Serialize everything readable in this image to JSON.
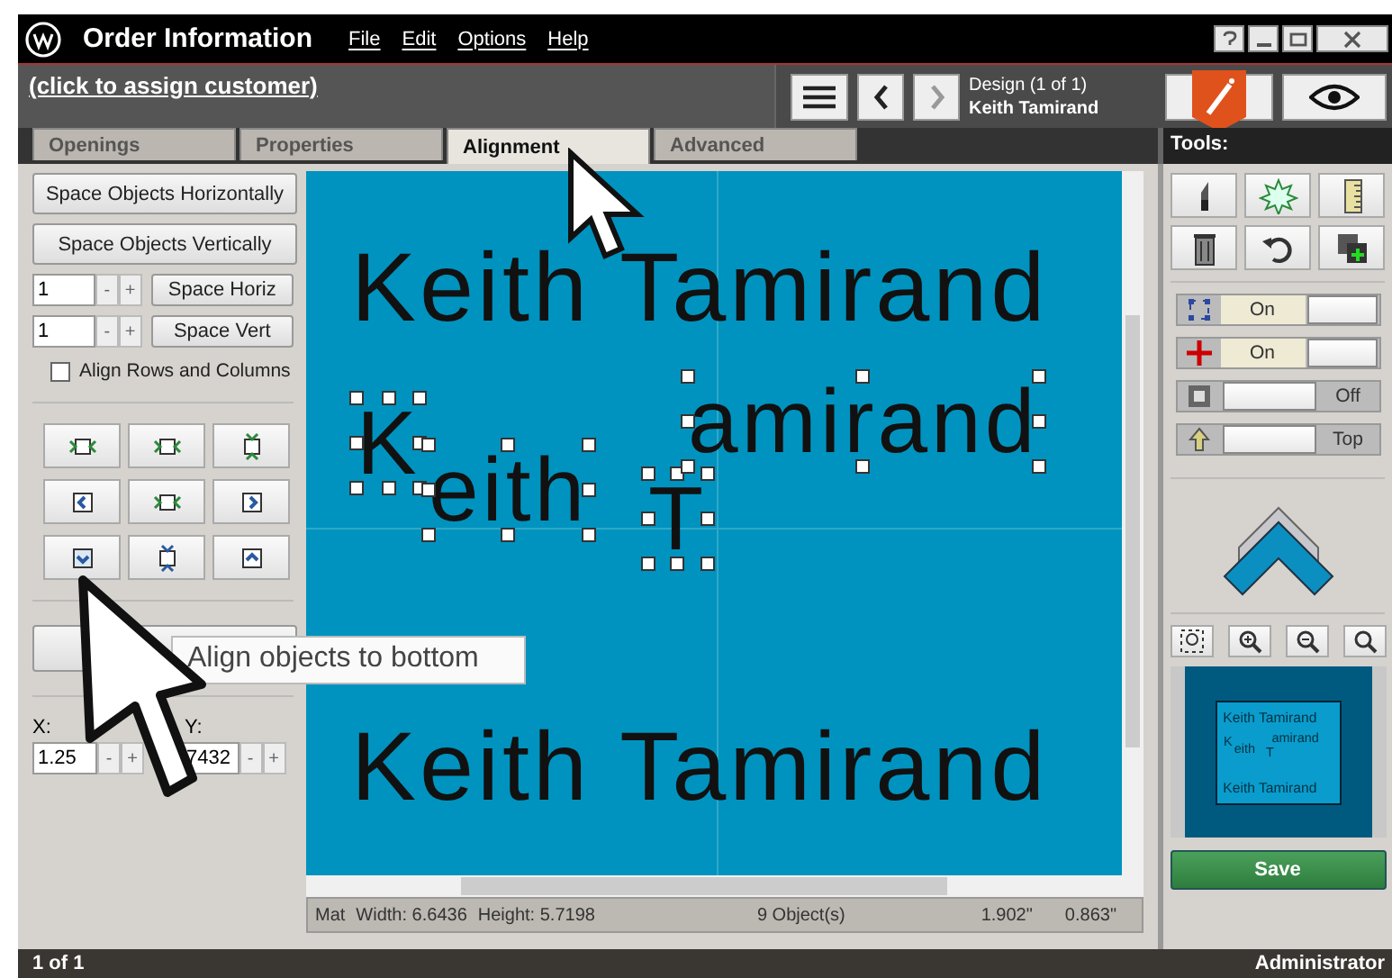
{
  "window": {
    "title": "Order Information",
    "menu": [
      "File",
      "Edit",
      "Options",
      "Help"
    ]
  },
  "customer_link": "(click to assign customer)",
  "design": {
    "label": "Design  (1 of 1)",
    "name": "Keith Tamirand"
  },
  "tabs": [
    {
      "label": "Openings",
      "selected": false
    },
    {
      "label": "Properties",
      "selected": false
    },
    {
      "label": "Alignment",
      "selected": true
    },
    {
      "label": "Advanced",
      "selected": false
    }
  ],
  "left_panel": {
    "buttons": [
      "Space Objects Horizontally",
      "Space Objects Vertically"
    ],
    "spacers": [
      {
        "value": "1",
        "minus": "-",
        "plus": "+",
        "button": "Space Horiz"
      },
      {
        "value": "1",
        "minus": "-",
        "plus": "+",
        "button": "Space Vert"
      }
    ],
    "align_rows": {
      "label": "Align Rows and Columns",
      "checked": false
    },
    "x": {
      "label": "X:",
      "value": "1.25",
      "minus": "-",
      "plus": "+"
    },
    "y": {
      "label": "Y:",
      "value": "7432",
      "minus": "-",
      "plus": "+"
    }
  },
  "canvas": {
    "objects": [
      {
        "text": "Keith Tamirand",
        "selected": false
      },
      {
        "text": "K",
        "selected": true
      },
      {
        "text": "eith",
        "selected": true
      },
      {
        "text": "T",
        "selected": true
      },
      {
        "text": "amirand",
        "selected": true
      },
      {
        "text": "Keith Tamirand",
        "selected": false
      }
    ],
    "status": {
      "mat": "Mat",
      "width": "Width: 6.6436",
      "height": "Height: 5.7198",
      "objects": "9 Object(s)",
      "x": "1.902\"",
      "y": "0.863\""
    }
  },
  "tooltip": "Align objects to bottom",
  "tools": {
    "title": "Tools:",
    "toggles": [
      {
        "label": "On",
        "on": true
      },
      {
        "label": "On",
        "on": true
      },
      {
        "label": "Off",
        "on": false
      },
      {
        "label": "Top",
        "on": false
      }
    ],
    "preview": [
      "Keith Tamirand",
      "K",
      "eith",
      "T",
      "amirand",
      "Keith Tamirand"
    ],
    "save": "Save"
  },
  "footer": {
    "left": "1 of 1",
    "right": "Administrator"
  }
}
